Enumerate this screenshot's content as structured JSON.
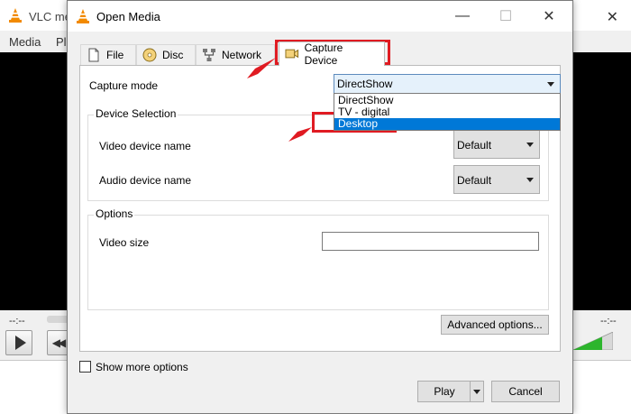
{
  "background_window": {
    "title": "VLC me",
    "menus": [
      "Media",
      "Pl"
    ],
    "time_left": "--:--",
    "time_right": "--:--"
  },
  "dialog": {
    "title": "Open Media",
    "tabs": [
      {
        "label": "File",
        "icon": "file-icon"
      },
      {
        "label": "Disc",
        "icon": "disc-icon"
      },
      {
        "label": "Network",
        "icon": "network-icon"
      },
      {
        "label": "Capture Device",
        "icon": "capture-device-icon"
      }
    ],
    "capture_mode": {
      "label": "Capture mode",
      "value": "DirectShow",
      "options": [
        "DirectShow",
        "TV - digital",
        "Desktop"
      ],
      "highlighted": "Desktop"
    },
    "device_selection": {
      "title": "Device Selection",
      "video_label": "Video device name",
      "video_value": "Default",
      "audio_label": "Audio device name",
      "audio_value": "Default"
    },
    "options": {
      "title": "Options",
      "video_size_label": "Video size",
      "video_size_value": ""
    },
    "advanced_button": "Advanced options...",
    "show_more_label": "Show more options",
    "play_button": "Play",
    "cancel_button": "Cancel"
  },
  "colors": {
    "highlight_red": "#e01b22",
    "selection_blue": "#0078d7",
    "combo_focus": "#e5f1fb",
    "vlc_orange": "#f28a00"
  }
}
